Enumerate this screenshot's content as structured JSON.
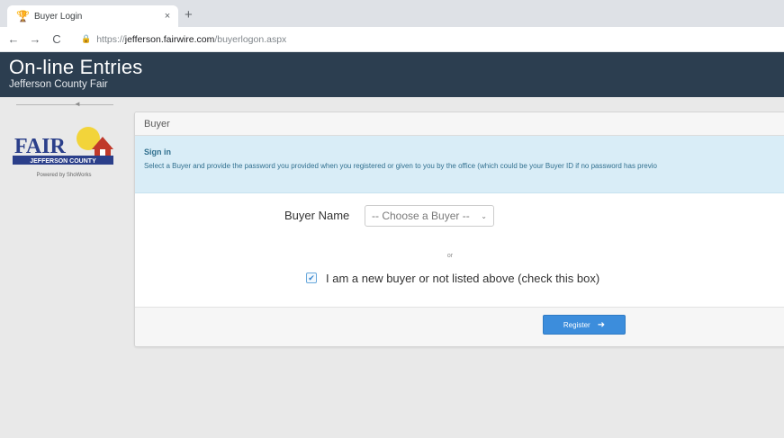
{
  "browser": {
    "tab_title": "Buyer Login",
    "tab_close": "×",
    "new_tab": "+",
    "url_scheme": "https://",
    "url_host": "jefferson.fairwire.com",
    "url_path": "/buyerlogon.aspx"
  },
  "header": {
    "title": "On-line Entries",
    "subtitle": "Jefferson County Fair"
  },
  "sidebar": {
    "logo_word": "FAIR",
    "logo_banner": "JEFFERSON COUNTY",
    "powered_by": "Powered by ShoWorks"
  },
  "panel": {
    "heading": "Buyer",
    "alert_title": "Sign in",
    "alert_text": "Select a Buyer and provide the password you provided when you registered or given to you by the office (which could be your Buyer ID if no password has previo",
    "buyer_label": "Buyer Name",
    "buyer_select_value": "-- Choose a Buyer --",
    "or_text": "or",
    "new_buyer_label": "I am a new buyer or not listed above (check this box)",
    "new_buyer_checked": true,
    "register_label": "Register"
  },
  "colors": {
    "header_bg": "#2c3e50",
    "alert_bg": "#d9edf7",
    "primary_button": "#3c8ddc"
  },
  "icons": {
    "favicon": "trophy-icon",
    "back": "arrow-left-icon",
    "forward": "arrow-right-icon",
    "reload": "reload-icon",
    "lock": "lock-icon",
    "select": "chevron-down-icon",
    "checkbox": "check-icon",
    "register": "arrow-right-icon"
  }
}
